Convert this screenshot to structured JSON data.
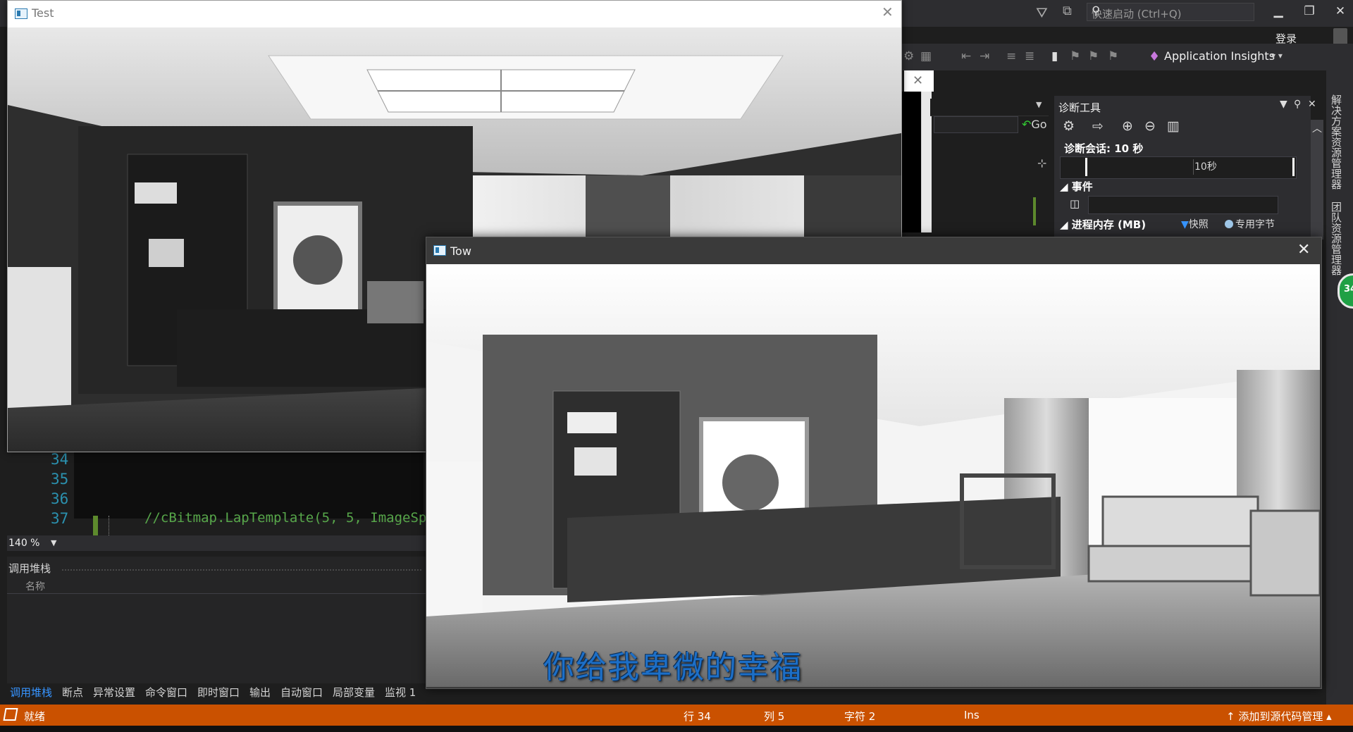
{
  "vs": {
    "quick_launch": "快速启动 (Ctrl+Q)",
    "login": "登录",
    "app_insights": "Application Insights",
    "go_label": "Go"
  },
  "diagnostics": {
    "title": "诊断工具",
    "session": "诊断会话: 10 秒",
    "timeline_label": "10秒",
    "events": "事件",
    "memory": "进程内存 (MB)",
    "snapshot": "快照",
    "private_bytes": "专用字节"
  },
  "right_tabs": [
    "解决方案资源管理器",
    "团队资源管理器"
  ],
  "badge_count": "34",
  "editor": {
    "line_numbers": [
      "34",
      "35",
      "36",
      "37"
    ],
    "code_line_37": "//cBitmap.LapTemplate(5, 5, ImageSp",
    "zoom": "140 %"
  },
  "callstack": {
    "title": "调用堆栈",
    "column_name": "名称"
  },
  "bottom_tabs": [
    "调用堆栈",
    "断点",
    "异常设置",
    "命令窗口",
    "即时窗口",
    "输出",
    "自动窗口",
    "局部变量",
    "监视 1"
  ],
  "status": {
    "ready": "就绪",
    "line": "行 34",
    "col": "列 5",
    "char": "字符 2",
    "mode": "Ins",
    "source_control": "添加到源代码管理"
  },
  "test_window": {
    "title": "Test"
  },
  "tow_window": {
    "title": "Tow",
    "subtitle": "你给我卑微的幸福"
  },
  "colors": {
    "status_bar": "#ca5100",
    "accent_blue": "#3794ff",
    "vs_dark": "#2d2d30"
  }
}
